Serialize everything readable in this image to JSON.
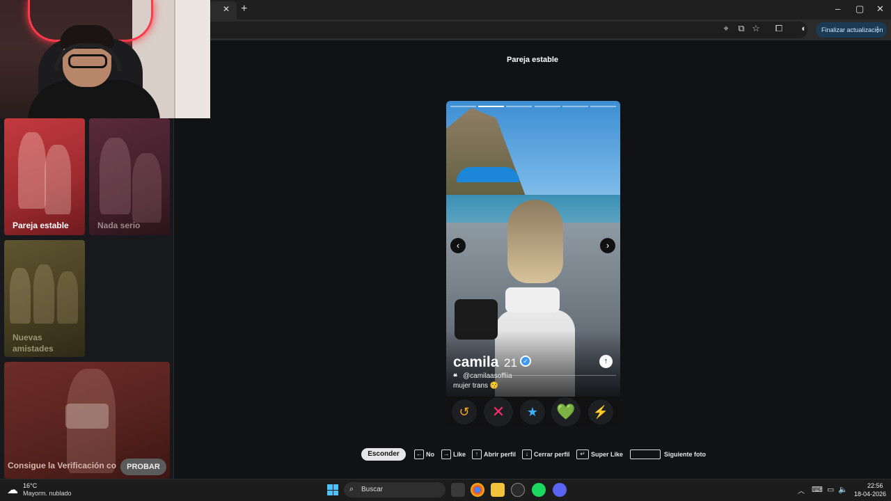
{
  "browser": {
    "tab_close": "✕",
    "new_tab": "+",
    "window_controls": [
      "–",
      "▢",
      "✕"
    ],
    "update_button": "Finalizar actualización"
  },
  "page": {
    "title": "Pareja estable"
  },
  "sidebar": {
    "cards": [
      {
        "label": "Pareja estable"
      },
      {
        "label": "Nada serio"
      },
      {
        "label": "Nuevas\namistades"
      },
      {
        "label": "Consigue la Verificación co"
      }
    ],
    "probar_button": "PROBAR"
  },
  "profile": {
    "name": "camila",
    "age": "21",
    "handle": "@camilaasoffiia",
    "bio": "mujer trans 😚",
    "photos_total": 6,
    "photo_current": 2
  },
  "actions": {
    "rewind": "↺",
    "nope": "✕",
    "super_like": "★",
    "like": "💚",
    "boost": "⚡"
  },
  "shortcuts": {
    "hide": "Esconder",
    "no": "No",
    "like": "Like",
    "open_profile": "Abrir perfil",
    "close_profile": "Cerrar perfil",
    "super_like": "Super Like",
    "next_photo": "Siguiente foto"
  },
  "taskbar": {
    "weather_temp": "16°C",
    "weather_desc": "Mayorm. nublado",
    "search_placeholder": "Buscar",
    "time": "22:56",
    "date": "18-04-2026"
  },
  "colors": {
    "accent_blue": "#3d97f5",
    "nope": "#ff2d6b",
    "super_like": "#3ab0ff",
    "like": "#7ee04a",
    "boost": "#c13bff",
    "rewind": "#f5a623"
  }
}
